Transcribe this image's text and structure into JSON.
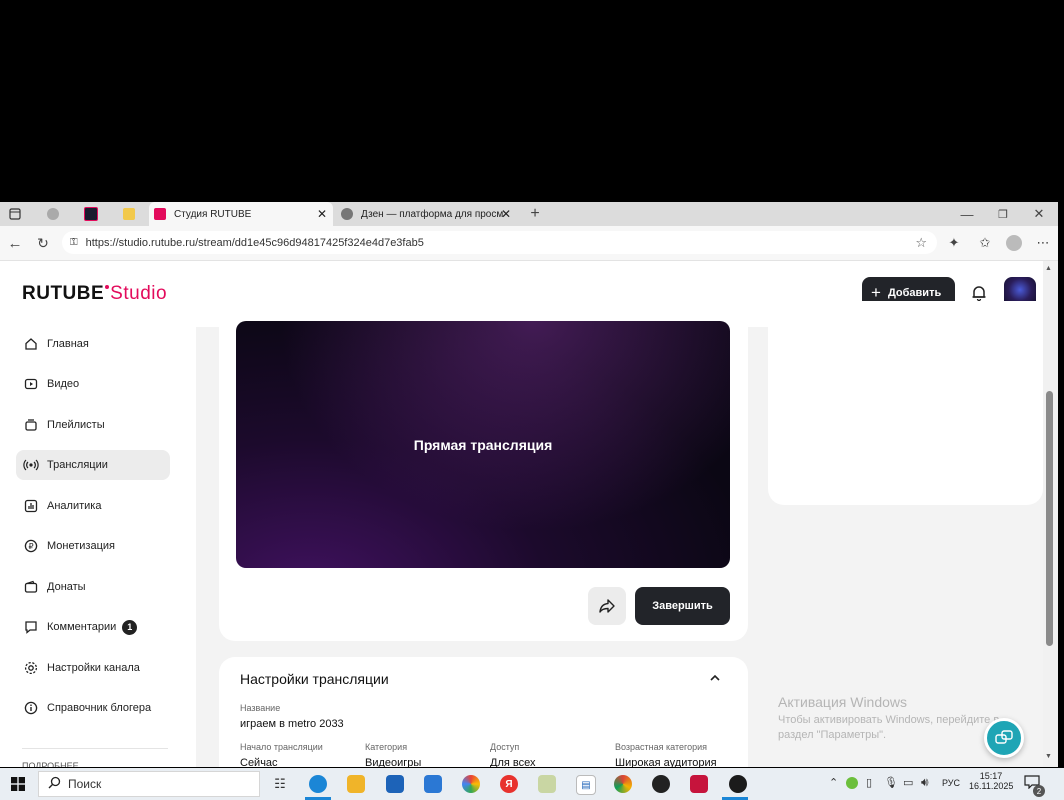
{
  "browser": {
    "tabs": [
      {
        "label": ""
      },
      {
        "label": ""
      },
      {
        "label": ""
      },
      {
        "label": "Студия RUTUBE"
      },
      {
        "label": "Дзен — платформа для просмо"
      }
    ],
    "url": "https://studio.rutube.ru/stream/dd1e45c96d94817425f324e4d7e3fab5"
  },
  "header": {
    "logo_main": "RUTUBE",
    "logo_suffix": "Studio",
    "add_label": "Добавить"
  },
  "sidebar": {
    "items": [
      {
        "label": "Главная"
      },
      {
        "label": "Видео"
      },
      {
        "label": "Плейлисты"
      },
      {
        "label": "Трансляции"
      },
      {
        "label": "Аналитика"
      },
      {
        "label": "Монетизация"
      },
      {
        "label": "Донаты"
      },
      {
        "label": "Комментарии",
        "badge": "1"
      },
      {
        "label": "Настройки канала"
      },
      {
        "label": "Справочник блогера"
      }
    ],
    "footer_partial": "ПОДРОБНЕЕ"
  },
  "player": {
    "title": "Прямая трансляция",
    "finish_label": "Завершить"
  },
  "settings": {
    "title": "Настройки трансляции",
    "name_label": "Название",
    "name_value": "играем в metro 2033",
    "fields": [
      {
        "label": "Начало трансляции",
        "value": "Сейчас"
      },
      {
        "label": "Категория",
        "value": "Видеоигры"
      },
      {
        "label": "Доступ",
        "value": "Для всех"
      },
      {
        "label": "Возрастная категория",
        "value": "Широкая аудитория"
      }
    ]
  },
  "watermark": {
    "line1": "Активация Windows",
    "line2": "Чтобы активировать Windows, перейдите в",
    "line3": "раздел \"Параметры\"."
  },
  "taskbar": {
    "search_label": "Поиск",
    "lang": "РУС",
    "time": "15:17",
    "date": "16.11.2025",
    "notif_count": "2"
  },
  "colors": {
    "brand_red": "#e30b5c",
    "dark_button": "#222429",
    "active_nav": "#ececec",
    "player_bg": "#160a24"
  }
}
